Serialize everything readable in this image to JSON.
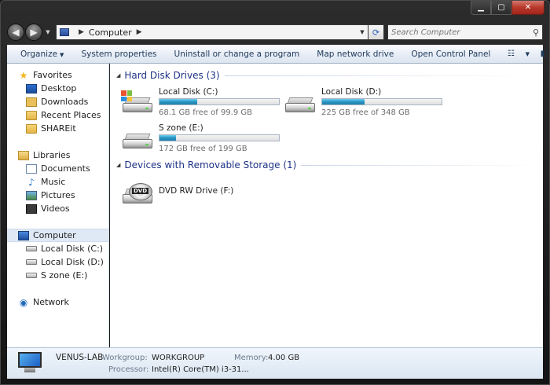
{
  "window": {
    "caption": {
      "minimize": "▁",
      "maximize": "▢",
      "close": "✕"
    }
  },
  "navigation": {
    "back_glyph": "◀",
    "forward_glyph": "▶",
    "address": {
      "crumb": "Computer",
      "separator": "▶"
    },
    "refresh_glyph": "⟳",
    "search_placeholder": "Search Computer",
    "search_glyph": "⚲"
  },
  "commandbar": {
    "organize": "Organize",
    "items": [
      "System properties",
      "Uninstall or change a program",
      "Map network drive",
      "Open Control Panel"
    ],
    "help": "?"
  },
  "sidebar": {
    "favorites": {
      "label": "Favorites",
      "items": [
        "Desktop",
        "Downloads",
        "Recent Places",
        "SHAREit"
      ]
    },
    "libraries": {
      "label": "Libraries",
      "items": [
        "Documents",
        "Music",
        "Pictures",
        "Videos"
      ]
    },
    "computer": {
      "label": "Computer",
      "items": [
        "Local Disk (C:)",
        "Local Disk (D:)",
        "S zone (E:)"
      ]
    },
    "network": {
      "label": "Network"
    }
  },
  "content": {
    "hard_disks_header": "Hard Disk Drives (3)",
    "drives": [
      {
        "name": "Local Disk (C:)",
        "free_text": "68.1 GB free of 99.9 GB",
        "used_fraction": 0.318
      },
      {
        "name": "Local Disk (D:)",
        "free_text": "225 GB free of 348 GB",
        "used_fraction": 0.353
      },
      {
        "name": "S zone (E:)",
        "free_text": "172 GB free of 199 GB",
        "used_fraction": 0.136
      }
    ],
    "removable_header": "Devices with Removable Storage (1)",
    "dvd": {
      "name": "DVD RW Drive (F:)",
      "badge": "DVD"
    }
  },
  "details": {
    "pc_name": "VENUS-LAB",
    "workgroup_label": "Workgroup:",
    "workgroup": "WORKGROUP",
    "memory_label": "Memory:",
    "memory": "4.00 GB",
    "processor_label": "Processor:",
    "processor": "Intel(R) Core(TM) i3-31..."
  },
  "colors": {
    "accent": "#1e3287",
    "bar_fill": "#2794c4",
    "close_button": "#b8382a"
  }
}
